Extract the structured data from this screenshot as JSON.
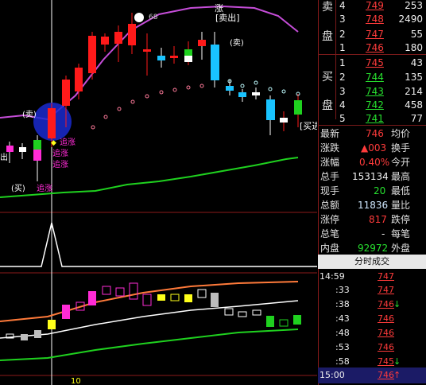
{
  "chart": {
    "colors": {
      "up": "#ff1a1a",
      "down": "#19c3ff",
      "flat": "#ffffff",
      "magenta": "#ff2bd6",
      "green": "#1fd11f",
      "orange": "#ff7a3a",
      "gray": "#bdbdbd",
      "yellow": "#ffff1a",
      "blue": "#2a3ad0",
      "purple": "#c54dd8"
    },
    "annotations": {
      "sell_label_top": "[卖出]",
      "rise_label": "涨",
      "buy_label_right": "[买进",
      "sell_label_mid": "(卖)",
      "sell_label_right": "(卖)",
      "chase_up_1": "追涨",
      "chase_up_2": "追涨",
      "chase_up_3": "追涨",
      "chase_up_bottom": "追涨",
      "buy_label_left": "(买)",
      "face_value": "68",
      "partial_left": "出",
      "x_tick": "10"
    }
  },
  "buy_levels": {
    "label_top": "买",
    "label_bottom": "盘",
    "rows": [
      {
        "n": "1",
        "price": "745",
        "vol": "43"
      },
      {
        "n": "2",
        "price": "744",
        "vol": "135"
      },
      {
        "n": "3",
        "price": "743",
        "vol": "214"
      },
      {
        "n": "4",
        "price": "742",
        "vol": "458"
      },
      {
        "n": "5",
        "price": "741",
        "vol": "77"
      }
    ]
  },
  "sell_levels": {
    "label_top": "卖",
    "label_bottom": "盘",
    "rows": [
      {
        "n": "4",
        "price": "749",
        "vol": "253"
      },
      {
        "n": "3",
        "price": "748",
        "vol": "2490"
      },
      {
        "n": "2",
        "price": "747",
        "vol": "55"
      },
      {
        "n": "1",
        "price": "746",
        "vol": "180"
      }
    ]
  },
  "stats": [
    {
      "l1": "最新",
      "v1": "746",
      "l2": "均价",
      "c": "red"
    },
    {
      "l1": "涨跌",
      "v1": "▲003",
      "l2": "换手",
      "c": "red"
    },
    {
      "l1": "涨幅",
      "v1": "0.40%",
      "l2": "今开",
      "c": "red"
    },
    {
      "l1": "总手",
      "v1": "153134",
      "l2": "最高",
      "c": "white"
    },
    {
      "l1": "现手",
      "v1": "20",
      "l2": "最低",
      "c": "green"
    },
    {
      "l1": "总额",
      "v1": "11836",
      "l2": "量比",
      "c": "cyan"
    },
    {
      "l1": "涨停",
      "v1": "817",
      "l2": "跌停",
      "c": "red"
    },
    {
      "l1": "总笔",
      "v1": "-",
      "l2": "每笔",
      "c": "white"
    },
    {
      "l1": "内盘",
      "v1": "92972",
      "l2": "外盘",
      "c": "green"
    }
  ],
  "ticks_title": "分时成交",
  "ticks": [
    {
      "time": "14:59",
      "price": "747",
      "arrow": "",
      "c": "red"
    },
    {
      "time": ":33",
      "price": "747",
      "arrow": "",
      "c": "red"
    },
    {
      "time": ":38",
      "price": "746",
      "arrow": "↓",
      "c": "red"
    },
    {
      "time": ":43",
      "price": "746",
      "arrow": "",
      "c": "red"
    },
    {
      "time": ":48",
      "price": "746",
      "arrow": "",
      "c": "red"
    },
    {
      "time": ":53",
      "price": "746",
      "arrow": "",
      "c": "red"
    },
    {
      "time": ":58",
      "price": "745",
      "arrow": "↓",
      "c": "red"
    },
    {
      "time": "15:00",
      "price": "746",
      "arrow": "↑",
      "c": "red"
    }
  ]
}
